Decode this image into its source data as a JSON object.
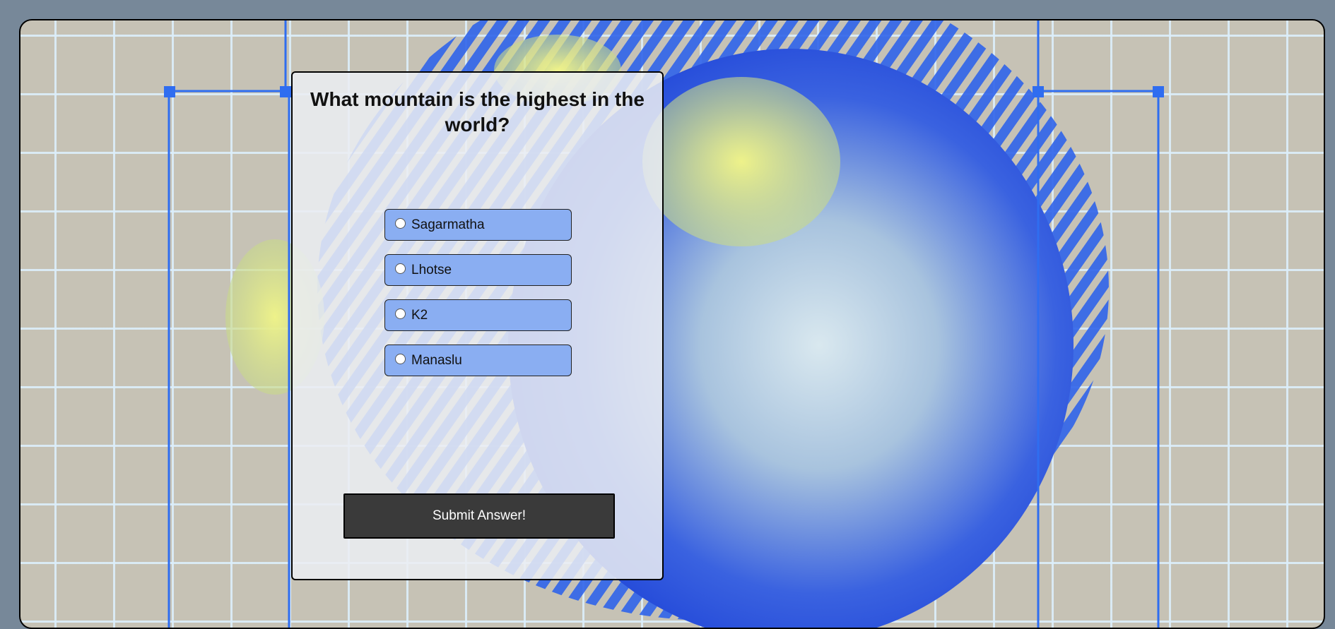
{
  "quiz": {
    "question": "What mountain is the highest in the world?",
    "options": [
      {
        "label": "Sagarmatha"
      },
      {
        "label": "Lhotse"
      },
      {
        "label": "K2"
      },
      {
        "label": "Manaslu"
      }
    ],
    "submit_label": "Submit Answer!"
  },
  "colors": {
    "page_bg": "#778899",
    "option_bg": "#8aaef2",
    "submit_bg": "#3a3a3a",
    "selection_handle": "#2f6df0"
  }
}
